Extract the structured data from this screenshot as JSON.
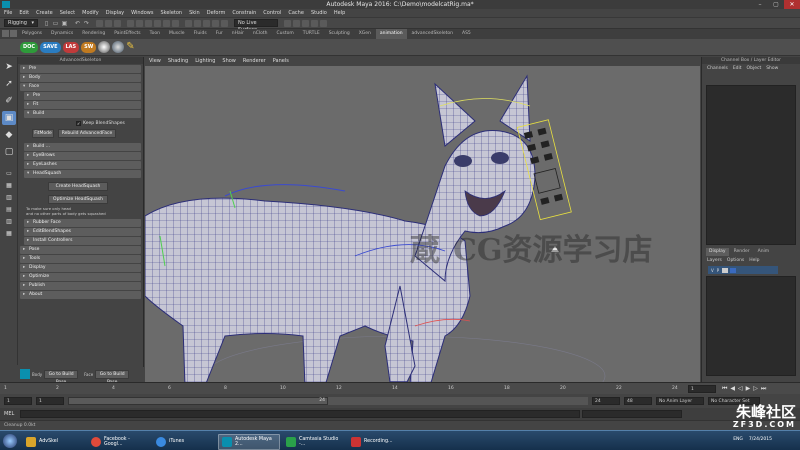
{
  "window": {
    "title": "Autodesk Maya 2016: C:\\Demo\\modelcatRig.ma*"
  },
  "menubar": [
    "File",
    "Edit",
    "Create",
    "Select",
    "Modify",
    "Display",
    "Windows",
    "Skeleton",
    "Skin",
    "Deform",
    "Constrain",
    "Control",
    "Cache",
    "Studio",
    "Help"
  ],
  "statusline": {
    "menuset": "Rigging",
    "surface_label": "No Live Surface"
  },
  "shelf_tabs": [
    "Polygons",
    "Dynamics",
    "Rendering",
    "PaintEffects",
    "Toon",
    "Muscle",
    "Fluids",
    "Fur",
    "nHair",
    "nCloth",
    "Custom",
    "TURTLE",
    "Sculpting",
    "XGen",
    "animation",
    "advancedSkeleton",
    "AS5"
  ],
  "shelf_active": "animation",
  "shelf_buttons": [
    "DOC",
    "SAVE",
    "LAS",
    "SW"
  ],
  "adv_panel": {
    "title": "AdvancedSkeleton",
    "sections": [
      "Pre",
      "Body",
      "Face"
    ],
    "face_sub": [
      "Pre",
      "Fit",
      "Build"
    ],
    "keep_blend_label": "Keep BlendShapes",
    "fitmode_label": "FitMode",
    "rebuild_label": "Rebuild AdvancedFace",
    "build_sections": [
      "Build ...",
      "EyeBrows",
      "EyeLashes",
      "HeadSquash"
    ],
    "create_head_squash": "Create HeadSquash",
    "optimize_head_squash": "Optimize HeadSquash",
    "note_line1": "To make sure only head",
    "note_line2": "and no other parts of body gets squashed",
    "after_sections": [
      "Rubber Face",
      "EditBlendShapes",
      "Install Controllers"
    ],
    "footer_sections": [
      "Pose",
      "Tools",
      "Display",
      "Optimize",
      "Publish",
      "About"
    ],
    "body_label": "Body",
    "body_button": "Go to Build Pose",
    "face_label": "Face",
    "face_button": "Go to Build Pose"
  },
  "viewport_menu": [
    "View",
    "Shading",
    "Lighting",
    "Show",
    "Renderer",
    "Panels"
  ],
  "channel_box": {
    "title": "Channel Box / Layer Editor",
    "menu": [
      "Channels",
      "Edit",
      "Object",
      "Show"
    ],
    "layer_tabs": [
      "Display",
      "Render",
      "Anim"
    ],
    "layer_menu": [
      "Layers",
      "Options",
      "Help"
    ],
    "layer_v": "V",
    "layer_p": "P"
  },
  "timeline": {
    "ticks": [
      "1",
      "2",
      "4",
      "6",
      "8",
      "10",
      "12",
      "14",
      "16",
      "18",
      "20",
      "22",
      "24"
    ],
    "current_frame": "1",
    "range_start": "1",
    "range_start2": "1",
    "range_mid": "24",
    "range_end": "24",
    "range_end2": "48",
    "anim_layer": "No Anim Layer",
    "char_set": "No Character Set"
  },
  "mel_label": "MEL",
  "help_line": "Cleanup        0.0kt",
  "watermark": "CG资源学习店",
  "watermark_left": "蔵",
  "logo": {
    "name": "朱峰社区",
    "url": "ZF3D.COM"
  },
  "taskbar": {
    "items": [
      {
        "label": "AdvSkel",
        "color": "#d9a52b"
      },
      {
        "label": "Facebook - Googl...",
        "color": "#e04a3a"
      },
      {
        "label": "iTunes",
        "color": "#3a8ae0"
      },
      {
        "label": "Autodesk Maya 2...",
        "color": "#0a8fae",
        "active": true
      },
      {
        "label": "Camtasia Studio -...",
        "color": "#2aa04a"
      },
      {
        "label": "Recording...",
        "color": "#cc3333"
      }
    ],
    "lang": "ENG",
    "time": "7/24/2015"
  }
}
